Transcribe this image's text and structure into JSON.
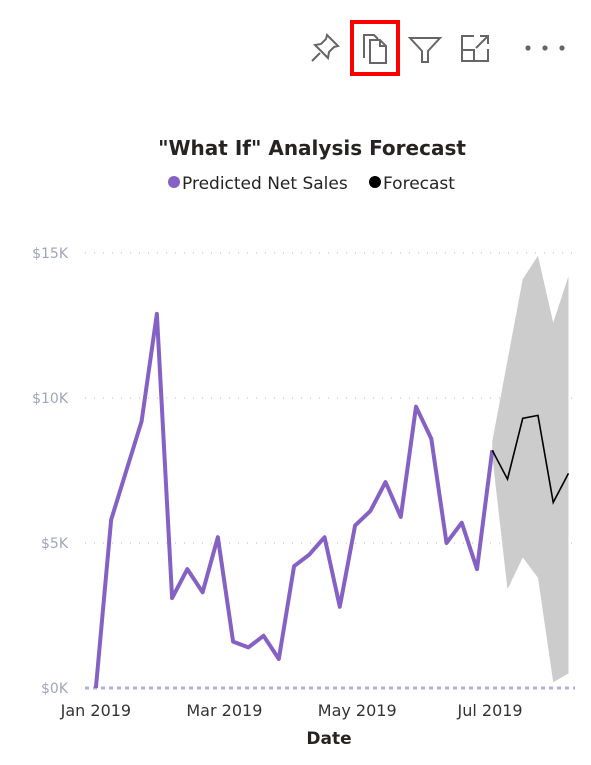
{
  "toolbar": {
    "items": [
      {
        "icon": "pin-icon",
        "label": "Pin visual"
      },
      {
        "icon": "copy-icon",
        "label": "Copy visual",
        "highlighted": true
      },
      {
        "icon": "filter-icon",
        "label": "Filters"
      },
      {
        "icon": "focus-mode-icon",
        "label": "Focus mode"
      },
      {
        "icon": "more-options-icon",
        "label": "More options"
      }
    ],
    "highlight_color": "#ff0000"
  },
  "chart_data": {
    "type": "line",
    "title": "\"What If\" Analysis Forecast",
    "xlabel": "Date",
    "ylabel": "",
    "x_tick_labels": [
      {
        "date": "2019-01-01",
        "label": "Jan 2019"
      },
      {
        "date": "2019-03-01",
        "label": "Mar 2019"
      },
      {
        "date": "2019-05-01",
        "label": "May 2019"
      },
      {
        "date": "2019-07-01",
        "label": "Jul 2019"
      }
    ],
    "y_ticks": [
      {
        "value": 0,
        "label": "$0K"
      },
      {
        "value": 5000,
        "label": "$5K"
      },
      {
        "value": 10000,
        "label": "$10K"
      },
      {
        "value": 15000,
        "label": "$15K"
      }
    ],
    "ylim": [
      0,
      15000
    ],
    "xlim": [
      "2018-12-27",
      "2019-08-09"
    ],
    "grid": "horizontal dotted",
    "legend_position": "top-center",
    "legend": [
      {
        "name": "Predicted Net Sales",
        "color": "#8661c5"
      },
      {
        "name": "Forecast",
        "color": "#000000"
      }
    ],
    "series": [
      {
        "name": "Predicted Net Sales",
        "color": "#8661c5",
        "x": [
          "2019-01-01",
          "2019-01-08",
          "2019-01-15",
          "2019-01-22",
          "2019-01-29",
          "2019-02-05",
          "2019-02-12",
          "2019-02-19",
          "2019-02-26",
          "2019-03-05",
          "2019-03-12",
          "2019-03-19",
          "2019-03-26",
          "2019-04-02",
          "2019-04-09",
          "2019-04-16",
          "2019-04-23",
          "2019-04-30",
          "2019-05-07",
          "2019-05-14",
          "2019-05-21",
          "2019-05-28",
          "2019-06-04",
          "2019-06-11",
          "2019-06-18",
          "2019-06-25",
          "2019-07-02"
        ],
        "values": [
          0,
          5800,
          7500,
          9200,
          12900,
          3100,
          4100,
          3300,
          5200,
          1600,
          1400,
          1800,
          1000,
          4200,
          4600,
          5200,
          2800,
          5600,
          6100,
          7100,
          5900,
          9700,
          8600,
          5000,
          5700,
          4100,
          8200
        ]
      },
      {
        "name": "Forecast",
        "color": "#000000",
        "x": [
          "2019-07-02",
          "2019-07-09",
          "2019-07-16",
          "2019-07-23",
          "2019-07-30",
          "2019-08-06"
        ],
        "values": [
          8200,
          7200,
          9300,
          9400,
          6400,
          7400
        ],
        "upper": [
          8500,
          11300,
          14100,
          14900,
          12600,
          14200
        ],
        "lower": [
          8000,
          3400,
          4500,
          3800,
          200,
          500
        ],
        "band_color": "#cccccc"
      }
    ]
  }
}
